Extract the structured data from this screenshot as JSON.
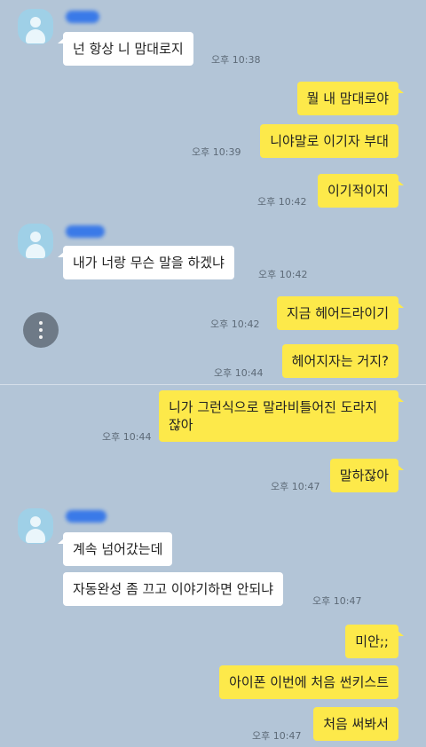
{
  "messages": [
    {
      "text": "넌 항상 니 맘대로지",
      "time": "오후 10:38"
    },
    {
      "text": "뭘 내 맘대로야"
    },
    {
      "text": "니야말로 이기자 부대",
      "time": "오후 10:39"
    },
    {
      "text": "이기적이지",
      "time": "오후 10:42"
    },
    {
      "text": "내가 너랑 무슨 말을 하겠냐",
      "time": "오후 10:42"
    },
    {
      "text": "지금 헤어드라이기",
      "time": "오후 10:42"
    },
    {
      "text": "헤어지자는 거지?",
      "time": "오후 10:44"
    },
    {
      "text": "니가 그런식으로 말라비틀어진 도라지 잖아",
      "time": "오후 10:44"
    },
    {
      "text": "말하잖아",
      "time": "오후 10:47"
    },
    {
      "text": "계속 넘어갔는데"
    },
    {
      "text": "자동완성 좀 끄고 이야기하면 안되냐",
      "time": "오후 10:47"
    },
    {
      "text": "미안;;"
    },
    {
      "text": "아이폰 이번에 처음 썬키스트"
    },
    {
      "text": "처음 써봐서",
      "time": "오후 10:47"
    }
  ],
  "colors": {
    "background": "#b3c5d7",
    "incoming_bubble": "#ffffff",
    "outgoing_bubble": "#fde94a",
    "sender_name_blur": "#2e72ea"
  },
  "icons": {
    "avatar": "default-profile-icon",
    "menu": "vertical-ellipsis-icon"
  }
}
